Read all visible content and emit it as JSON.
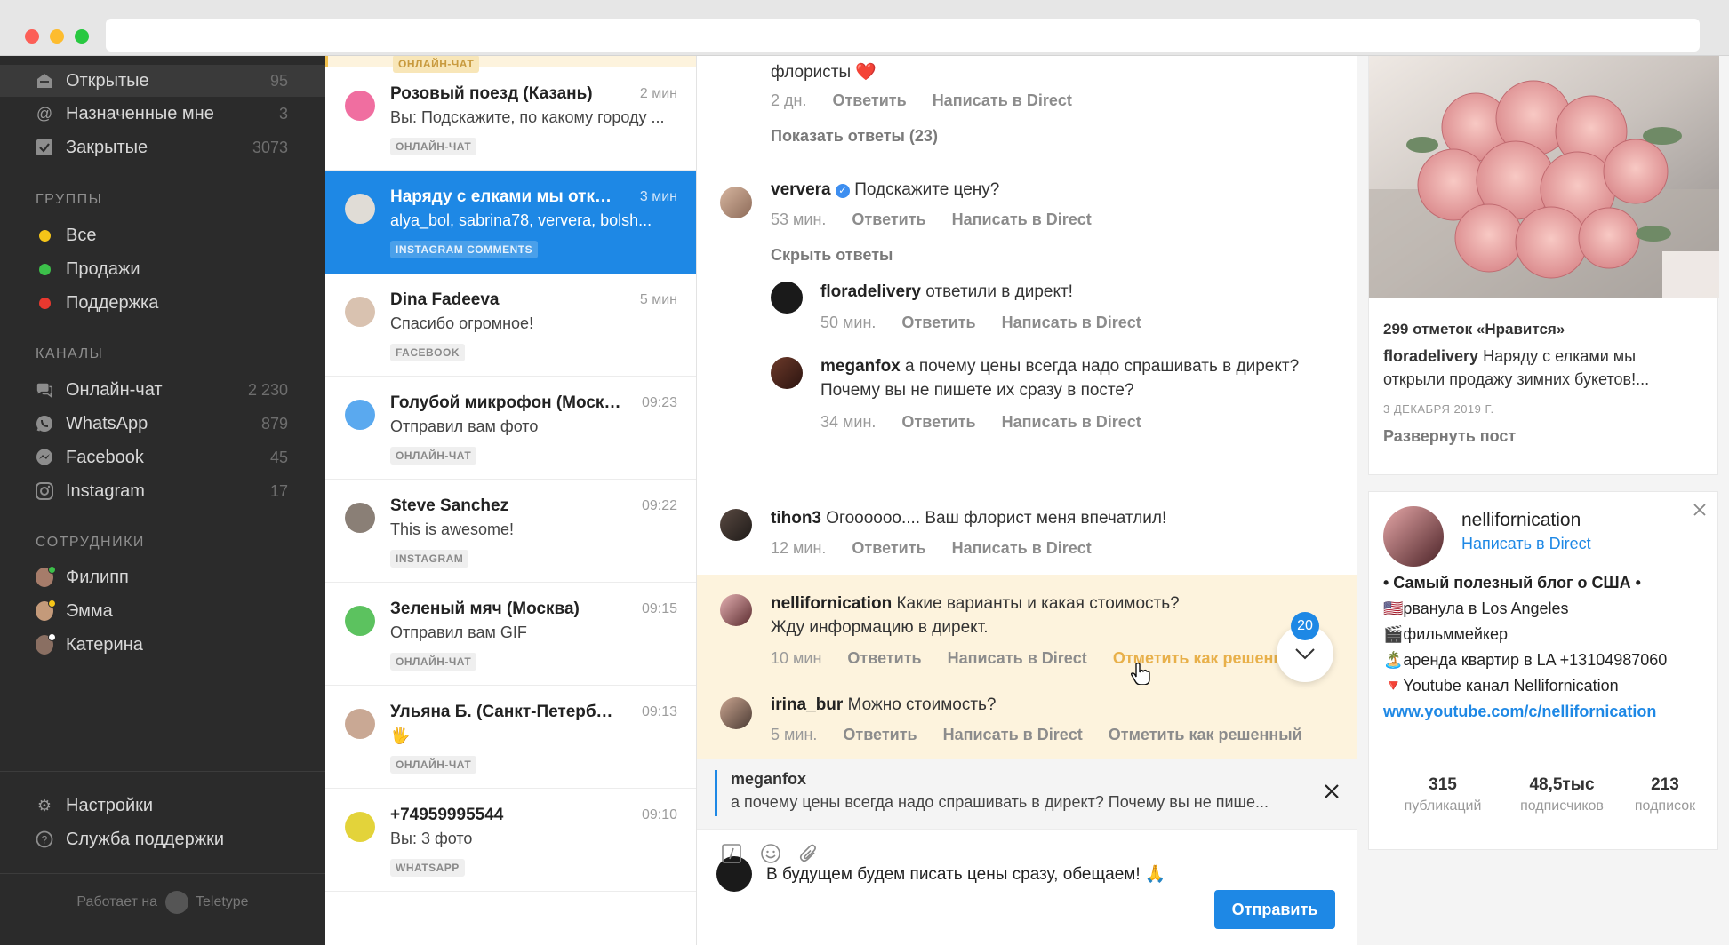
{
  "sidebar": {
    "inbox": [
      {
        "icon": "inbox-icon",
        "label": "Открытые",
        "count": "95"
      },
      {
        "icon": "at-icon",
        "label": "Назначенные мне",
        "count": "3"
      },
      {
        "icon": "checkbox-icon",
        "label": "Закрытые",
        "count": "3073"
      }
    ],
    "groups_title": "ГРУППЫ",
    "groups": [
      {
        "label": "Все",
        "color": "#f5c518"
      },
      {
        "label": "Продажи",
        "color": "#3cc04a"
      },
      {
        "label": "Поддержка",
        "color": "#e8382f"
      }
    ],
    "channels_title": "КАНАЛЫ",
    "channels": [
      {
        "icon": "chat-bubble-icon",
        "label": "Онлайн-чат",
        "count": "2 230"
      },
      {
        "icon": "whatsapp-icon",
        "label": "WhatsApp",
        "count": "879"
      },
      {
        "icon": "messenger-icon",
        "label": "Facebook",
        "count": "45"
      },
      {
        "icon": "instagram-icon",
        "label": "Instagram",
        "count": "17"
      }
    ],
    "staff_title": "СОТРУДНИКИ",
    "staff": [
      {
        "label": "Филипп",
        "status": "#3cc04a"
      },
      {
        "label": "Эмма",
        "status": "#f5c518"
      },
      {
        "label": "Катерина",
        "status": "#ffffff"
      }
    ],
    "settings_label": "Настройки",
    "support_label": "Служба поддержки",
    "powered_label": "Работает на",
    "powered_brand": "Teletype"
  },
  "conversations": {
    "first_tag": "ОНЛАЙН-ЧАТ",
    "items": [
      {
        "title": "Розовый поезд (Казань)",
        "time": "2 мин",
        "preview": "Вы: Подскажите, по какому городу ...",
        "tag": "ОНЛАЙН-ЧАТ",
        "color": "#f06ea0"
      },
      {
        "title": "Наряду с елками мы откры...",
        "time": "3 мин",
        "preview": "alya_bol, sabrina78, ververa, bolsh...",
        "tag": "INSTAGRAM COMMENTS",
        "color": "#e0dcd6"
      },
      {
        "title": "Dina Fadeeva",
        "time": "5 мин",
        "preview": "Спасибо огромное!",
        "tag": "FACEBOOK",
        "color": "#d9c2b0"
      },
      {
        "title": "Голубой микрофон (Москва)",
        "time": "09:23",
        "preview": "Отправил вам фото",
        "tag": "ОНЛАЙН-ЧАТ",
        "color": "#5aa9ef"
      },
      {
        "title": "Steve Sanchez",
        "time": "09:22",
        "preview": "This is awesome!",
        "tag": "INSTAGRAM",
        "color": "#8a7f76"
      },
      {
        "title": "Зеленый мяч (Москва)",
        "time": "09:15",
        "preview": "Отправил вам GIF",
        "tag": "ОНЛАЙН-ЧАТ",
        "color": "#5cc25f"
      },
      {
        "title": "Ульяна Б. (Санкт-Петербург)",
        "time": "09:13",
        "preview": "🖐",
        "tag": "ОНЛАЙН-ЧАТ",
        "color": "#c9a894"
      },
      {
        "title": "+74959995544",
        "time": "09:10",
        "preview": "Вы: 3 фото",
        "tag": "WHATSAPP",
        "color": "#e3d33a"
      }
    ]
  },
  "thread": {
    "top_text": "флористы ❤️",
    "top_meta": {
      "time": "2 дн.",
      "reply": "Ответить",
      "direct": "Написать в Direct"
    },
    "show_replies": "Показать ответы (23)",
    "c1": {
      "user": "ververa",
      "text": "Подскажите цену?",
      "time": "53 мин.",
      "reply": "Ответить",
      "direct": "Написать в Direct"
    },
    "hide_replies": "Скрыть ответы",
    "r1": {
      "user": "floradelivery",
      "text": "ответили в директ!",
      "time": "50 мин.",
      "reply": "Ответить",
      "direct": "Написать в Direct"
    },
    "r2": {
      "user": "meganfox",
      "text": "а почему цены всегда надо спрашивать в директ?",
      "text2": "Почему вы не пишете их сразу в посте?",
      "time": "34 мин.",
      "reply": "Ответить",
      "direct": "Написать в Direct"
    },
    "c2": {
      "user": "tihon3",
      "text": "Огоооооо.... Ваш флорист меня впечатлил!",
      "time": "12 мин.",
      "reply": "Ответить",
      "direct": "Написать в Direct"
    },
    "c3": {
      "user": "nellifornication",
      "text": "Какие варианты и какая стоимость?",
      "text2": "Жду информацию в директ.",
      "time": "10 мин",
      "reply": "Ответить",
      "direct": "Написать в Direct",
      "resolve": "Отметить как решенный"
    },
    "c4": {
      "user": "irina_bur",
      "text": "Можно стоимость?",
      "time": "5 мин.",
      "reply": "Ответить",
      "direct": "Написать в Direct",
      "resolve": "Отметить как решенный"
    },
    "unread_badge": "20",
    "reply_to": {
      "user": "meganfox",
      "text": "а почему цены всегда надо спрашивать в директ? Почему вы не пише..."
    },
    "composer_text": "В будущем будем писать цены сразу, обещаем! 🙏",
    "send_label": "Отправить"
  },
  "post": {
    "likes": "299 отметок «Нравится»",
    "author": "floradelivery",
    "caption": "Наряду с елками мы",
    "caption2": "открыли продажу зимних букетов!...",
    "date": "3 ДЕКАБРЯ 2019 Г.",
    "expand": "Развернуть пост"
  },
  "profile": {
    "name": "nellifornication",
    "direct": "Написать в Direct",
    "bio": [
      "• Самый полезный блог о США •",
      "🇺🇸рванула в Los Angeles",
      "🎬фильммейкер",
      "🏝️аренда квартир в LA +13104987060",
      "🔻Youtube канал Nellifornication"
    ],
    "link": "www.youtube.com/c/nellifornication",
    "stats": [
      {
        "n": "315",
        "l": "публикаций"
      },
      {
        "n": "48,5тыс",
        "l": "подписчиков"
      },
      {
        "n": "213",
        "l": "подписок"
      }
    ]
  },
  "colors": {
    "accent": "#1e88e5",
    "sidebar_bg": "#2b2b2b",
    "highlight": "#fdf3dd",
    "resolve_active": "#e8b04a"
  }
}
